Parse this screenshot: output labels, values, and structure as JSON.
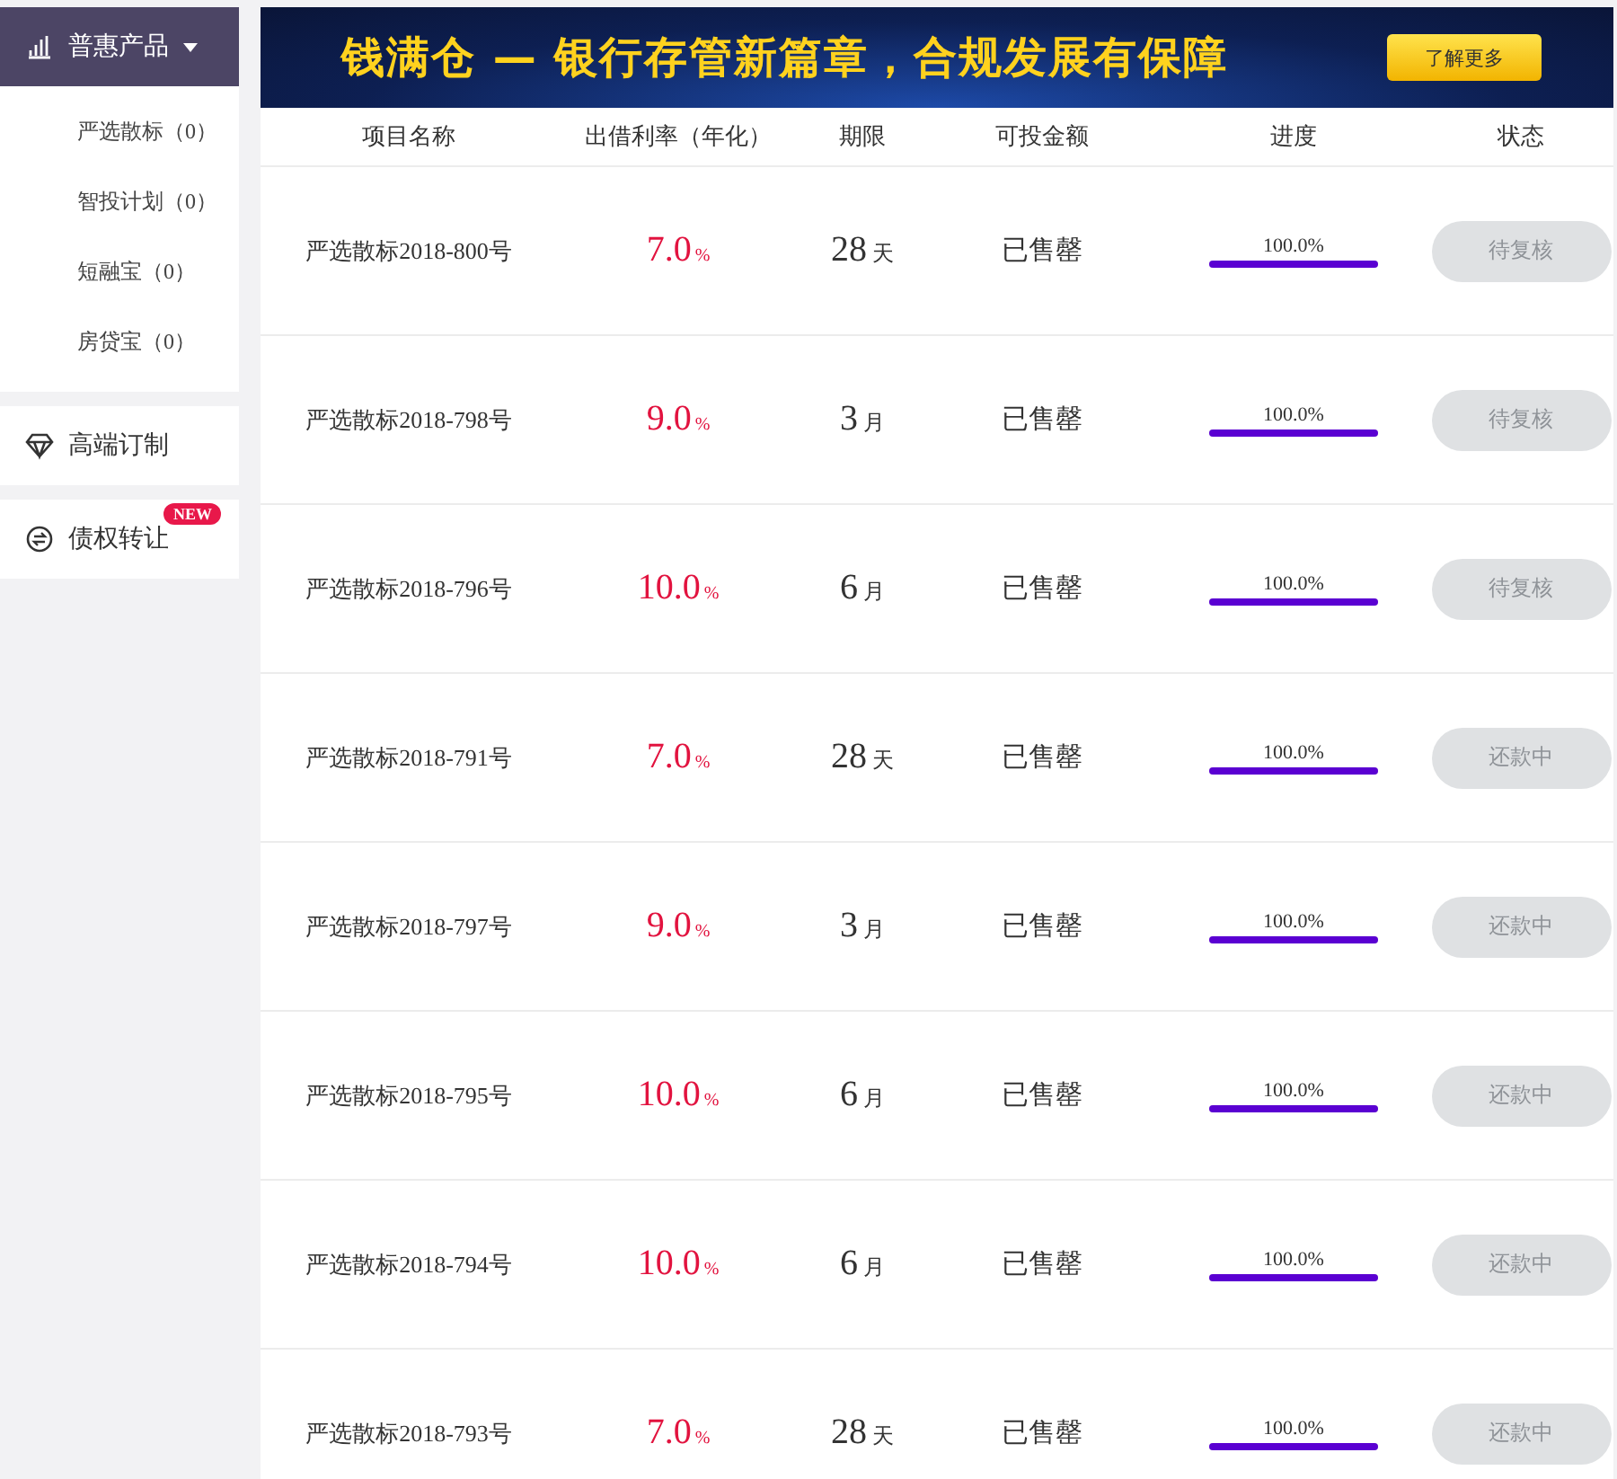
{
  "sidebar": {
    "groups": [
      {
        "label": "普惠产品",
        "expanded": true,
        "selected": true,
        "children": [
          {
            "label": "严选散标（0）"
          },
          {
            "label": "智投计划（0）"
          },
          {
            "label": "短融宝（0）"
          },
          {
            "label": "房贷宝（0）"
          }
        ]
      },
      {
        "label": "高端订制",
        "selected": false
      },
      {
        "label": "债权转让",
        "selected": false,
        "badge": "NEW"
      }
    ]
  },
  "banner": {
    "headline": "钱满仓 — 银行存管新篇章，合规发展有保障",
    "button": "了解更多"
  },
  "table": {
    "columns": [
      "项目名称",
      "出借利率（年化）",
      "期限",
      "可投金额",
      "进度",
      "状态"
    ],
    "rows": [
      {
        "name": "严选散标2018-800号",
        "rate": "7.0",
        "rate_unit": "%",
        "term": "28",
        "term_unit": "天",
        "amount": "已售罄",
        "progress": "100.0%",
        "level": 1,
        "status": "待复核",
        "disabled": true
      },
      {
        "name": "严选散标2018-798号",
        "rate": "9.0",
        "rate_unit": "%",
        "term": "3",
        "term_unit": "月",
        "amount": "已售罄",
        "progress": "100.0%",
        "level": 1,
        "status": "待复核",
        "disabled": true
      },
      {
        "name": "严选散标2018-796号",
        "rate": "10.0",
        "rate_unit": "%",
        "term": "6",
        "term_unit": "月",
        "amount": "已售罄",
        "progress": "100.0%",
        "level": 1,
        "status": "待复核",
        "disabled": true
      },
      {
        "name": "严选散标2018-791号",
        "rate": "7.0",
        "rate_unit": "%",
        "term": "28",
        "term_unit": "天",
        "amount": "已售罄",
        "progress": "100.0%",
        "level": 1,
        "status": "还款中",
        "disabled": true
      },
      {
        "name": "严选散标2018-797号",
        "rate": "9.0",
        "rate_unit": "%",
        "term": "3",
        "term_unit": "月",
        "amount": "已售罄",
        "progress": "100.0%",
        "level": 1,
        "status": "还款中",
        "disabled": true
      },
      {
        "name": "严选散标2018-795号",
        "rate": "10.0",
        "rate_unit": "%",
        "term": "6",
        "term_unit": "月",
        "amount": "已售罄",
        "progress": "100.0%",
        "level": 1,
        "status": "还款中",
        "disabled": true
      },
      {
        "name": "严选散标2018-794号",
        "rate": "10.0",
        "rate_unit": "%",
        "term": "6",
        "term_unit": "月",
        "amount": "已售罄",
        "progress": "100.0%",
        "level": 1,
        "status": "还款中",
        "disabled": true
      },
      {
        "name": "严选散标2018-793号",
        "rate": "7.0",
        "rate_unit": "%",
        "term": "28",
        "term_unit": "天",
        "amount": "已售罄",
        "progress": "100.0%",
        "level": 1,
        "status": "还款中",
        "disabled": true
      }
    ]
  }
}
